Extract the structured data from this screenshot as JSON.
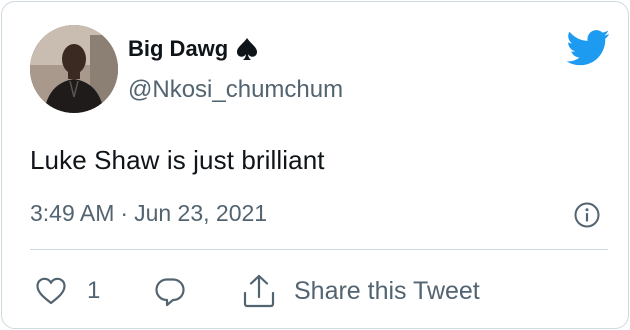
{
  "user": {
    "display_name": "Big Dawg",
    "handle": "@Nkosi_chumchum",
    "badge_icon": "spade-icon"
  },
  "tweet": {
    "text": "Luke Shaw is just brilliant",
    "time": "3:49 AM",
    "separator": "·",
    "date": "Jun 23, 2021"
  },
  "actions": {
    "like_count": "1",
    "share_label": "Share this Tweet"
  },
  "colors": {
    "brand": "#1d9bf0",
    "secondary_text": "#536471",
    "primary_text": "#0f1419",
    "border": "#cfd9de"
  }
}
